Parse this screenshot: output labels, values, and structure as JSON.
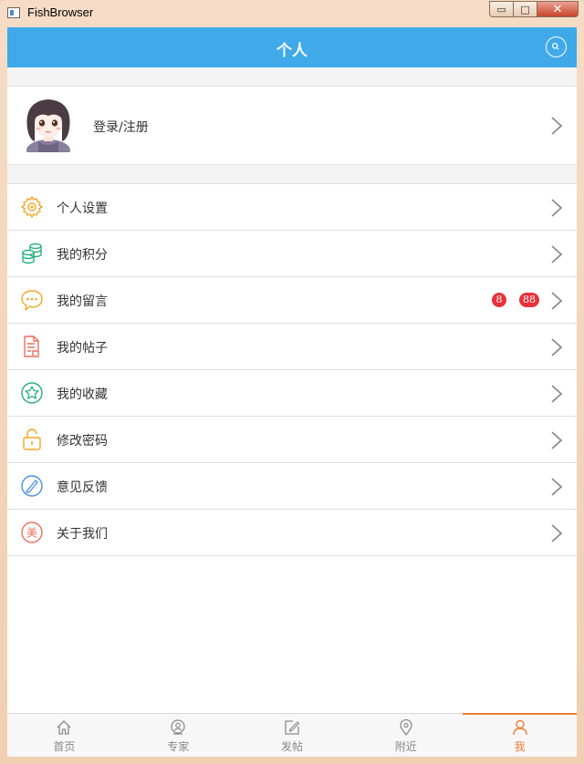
{
  "window": {
    "title": "FishBrowser",
    "min": "▭",
    "max": "□",
    "close": "✕"
  },
  "header": {
    "title": "个人",
    "search_icon": "search-icon"
  },
  "profile": {
    "login_label": "登录/注册"
  },
  "menu": [
    {
      "label": "个人设置",
      "icon": "gear-icon",
      "color": "#f5a623"
    },
    {
      "label": "我的积分",
      "icon": "coins-icon",
      "color": "#27b07a"
    },
    {
      "label": "我的留言",
      "icon": "message-icon",
      "color": "#f5a623",
      "badges": [
        "8",
        "88"
      ]
    },
    {
      "label": "我的帖子",
      "icon": "document-icon",
      "color": "#ec6f5e"
    },
    {
      "label": "我的收藏",
      "icon": "star-icon",
      "color": "#27b07a"
    },
    {
      "label": "修改密码",
      "icon": "lock-icon",
      "color": "#f5a623"
    },
    {
      "label": "意见反馈",
      "icon": "pen-icon",
      "color": "#4a90e2"
    },
    {
      "label": "关于我们",
      "icon": "about-icon",
      "color": "#ec6f5e",
      "glyph": "美"
    }
  ],
  "tabs": [
    {
      "label": "首页",
      "icon": "home-icon"
    },
    {
      "label": "专家",
      "icon": "expert-icon"
    },
    {
      "label": "发帖",
      "icon": "post-icon"
    },
    {
      "label": "附近",
      "icon": "location-icon"
    },
    {
      "label": "我",
      "icon": "user-icon",
      "active": true
    }
  ],
  "colors": {
    "header": "#40a9ea",
    "active_tab": "#f07c34",
    "badge": "#e8323c"
  }
}
